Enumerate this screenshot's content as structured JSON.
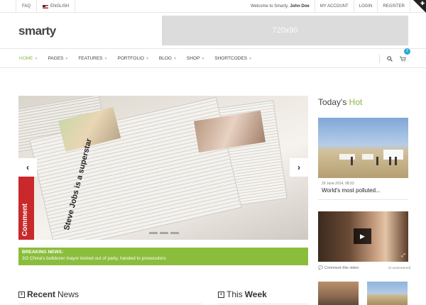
{
  "topbar": {
    "faq": "FAQ",
    "language": "ENGLISH",
    "welcome_prefix": "Welcome to Smarty,",
    "user_name": "John Doe",
    "my_account": "MY ACCOUNT",
    "login": "LOGIN",
    "register": "REGISTER"
  },
  "header": {
    "logo": "smarty",
    "ad_text": "720x90"
  },
  "nav": {
    "items": [
      {
        "label": "HOME",
        "active": true
      },
      {
        "label": "PAGES"
      },
      {
        "label": "FEATURES"
      },
      {
        "label": "PORTFOLIO"
      },
      {
        "label": "BLOG"
      },
      {
        "label": "SHOP"
      },
      {
        "label": "SHORTCODES"
      }
    ],
    "cart_count": "2",
    "accent_color": "#8ab844"
  },
  "slider": {
    "headline": "Steve Jobs is a superstar",
    "brand": "Comment",
    "prev_icon": "chevron-left-icon",
    "next_icon": "chevron-right-icon"
  },
  "breaking": {
    "label": "BREAKING NEWS:",
    "text": "3/3 China's bulldozer mayor kicked out of party, handed to prosecutors"
  },
  "sections": {
    "recent_bold": "Recent",
    "recent_rest": "News",
    "this_plain": "This",
    "week_bold": "Week"
  },
  "sidebar": {
    "title_plain": "Today's",
    "title_highlight": "Hot",
    "post1_date": "29 June 2014, 08:33",
    "post1_title": "World's most polluted...",
    "video_comment": "Comment this video",
    "video_status": "(0 unanswered)"
  }
}
